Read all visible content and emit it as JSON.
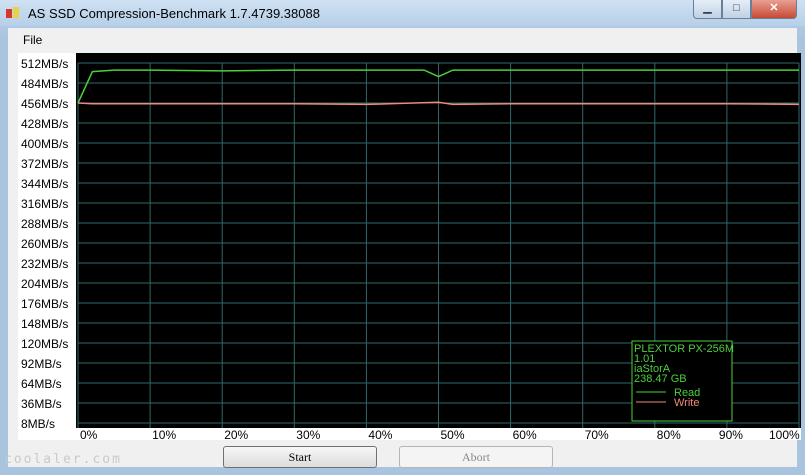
{
  "window": {
    "title": "AS SSD Compression-Benchmark 1.7.4739.38088"
  },
  "menu": {
    "file_label": "File"
  },
  "buttons": {
    "start_label": "Start",
    "abort_label": "Abort"
  },
  "info_box": {
    "device": "PLEXTOR PX-256M",
    "firmware": "1.01",
    "driver": "iaStorA",
    "capacity": "238.47 GB",
    "read_label": "Read",
    "write_label": "Write"
  },
  "watermark": "coolaler.com",
  "colors": {
    "read": "#4ccf3b",
    "write": "#f08a7a",
    "grid": "#2f6a6a",
    "label_bg": "#ffffff"
  },
  "chart_data": {
    "type": "line",
    "title": "",
    "y_tick_labels": [
      "512MB/s",
      "484MB/s",
      "456MB/s",
      "428MB/s",
      "400MB/s",
      "372MB/s",
      "344MB/s",
      "316MB/s",
      "288MB/s",
      "260MB/s",
      "232MB/s",
      "204MB/s",
      "176MB/s",
      "148MB/s",
      "120MB/s",
      "92MB/s",
      "64MB/s",
      "36MB/s",
      "8MB/s"
    ],
    "x_tick_labels": [
      "0%",
      "10%",
      "20%",
      "30%",
      "40%",
      "50%",
      "60%",
      "70%",
      "80%",
      "90%",
      "100%"
    ],
    "ylim": [
      8,
      512
    ],
    "xlim": [
      0,
      100
    ],
    "series": [
      {
        "name": "Read",
        "x": [
          0,
          2,
          5,
          10,
          20,
          30,
          40,
          48,
          50,
          52,
          60,
          70,
          80,
          90,
          100
        ],
        "values": [
          456,
          500,
          502,
          502,
          501,
          502,
          502,
          502,
          493,
          502,
          502,
          502,
          502,
          502,
          502
        ]
      },
      {
        "name": "Write",
        "x": [
          0,
          2,
          5,
          10,
          20,
          30,
          40,
          50,
          52,
          60,
          70,
          80,
          90,
          100
        ],
        "values": [
          456,
          455,
          455,
          455,
          455,
          455,
          454,
          457,
          454,
          455,
          455,
          455,
          455,
          454
        ]
      }
    ]
  }
}
